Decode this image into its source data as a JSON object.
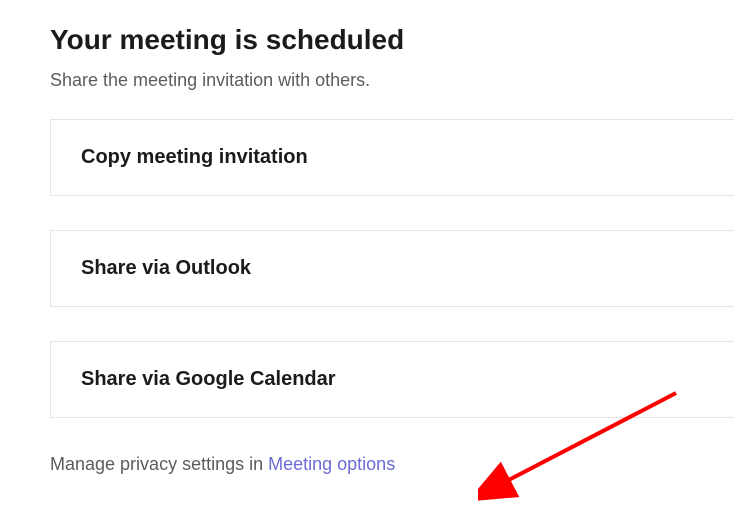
{
  "heading": "Your meeting is scheduled",
  "subheading": "Share the meeting invitation with others.",
  "actions": {
    "copy": "Copy meeting invitation",
    "outlook": "Share via Outlook",
    "google": "Share via Google Calendar"
  },
  "footer": {
    "prefix": "Manage privacy settings in ",
    "link": "Meeting options"
  }
}
